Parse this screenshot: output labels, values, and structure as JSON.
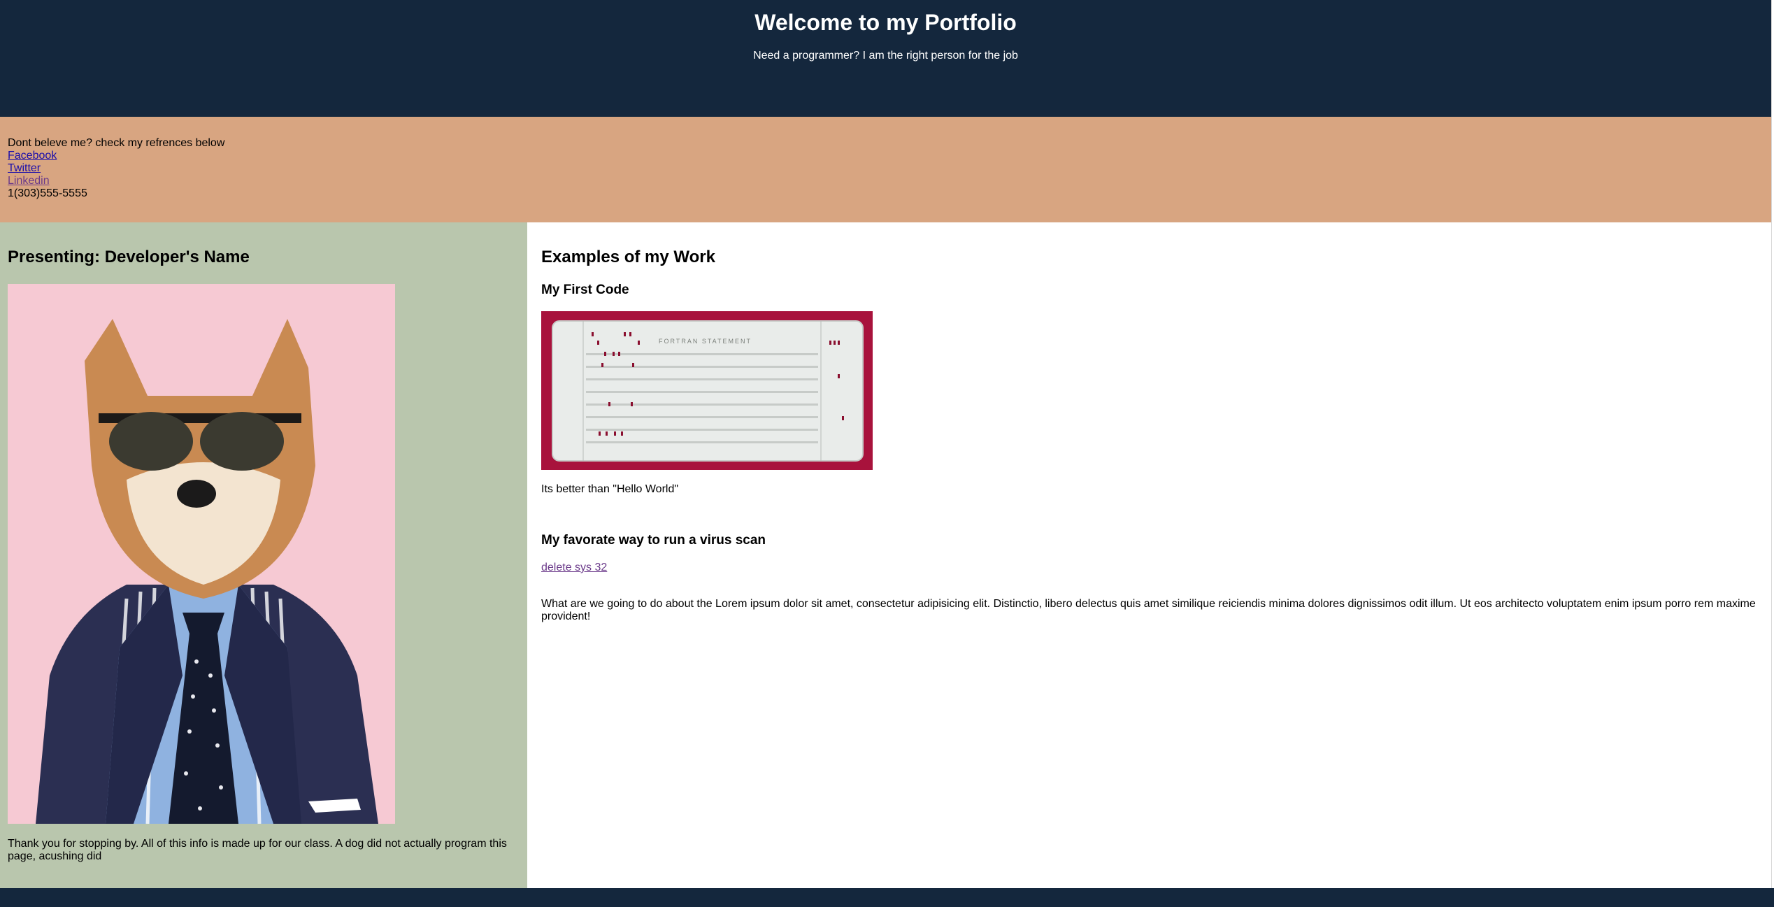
{
  "header": {
    "title": "Welcome to my Portfolio",
    "subtitle": "Need a programmer? I am the right person for the job"
  },
  "references": {
    "intro": "Dont beleve me? check my refrences below",
    "links": [
      "Facebook",
      "Twitter",
      "Linkedin"
    ],
    "phone": "1(303)555-5555"
  },
  "profile": {
    "heading": "Presenting: Developer's Name",
    "photo_icon": "dog-in-suit-photo",
    "caption": "Thank you for stopping by. All of this info is made up for our class. A dog did not actually program this page, acushing did"
  },
  "work": {
    "heading": "Examples of my Work",
    "item1": {
      "title": "My First Code",
      "image_icon": "punch-card-photo",
      "card_label": "FORTRAN STATEMENT",
      "caption": "Its better than \"Hello World\""
    },
    "item2": {
      "title": "My favorate way to run a virus scan",
      "image_alt": "delete sys 32",
      "caption": "What are we going to do about the Lorem ipsum dolor sit amet, consectetur adipisicing elit. Distinctio, libero delectus quis amet similique reiciendis minima dolores dignissimos odit illum. Ut eos architecto voluptatem enim ipsum porro rem maxime provident!"
    }
  },
  "colors": {
    "header_bg": "#14273d",
    "refs_bg": "#d8a581",
    "left_bg": "#b9c6ad",
    "right_bg": "#ffffff"
  }
}
